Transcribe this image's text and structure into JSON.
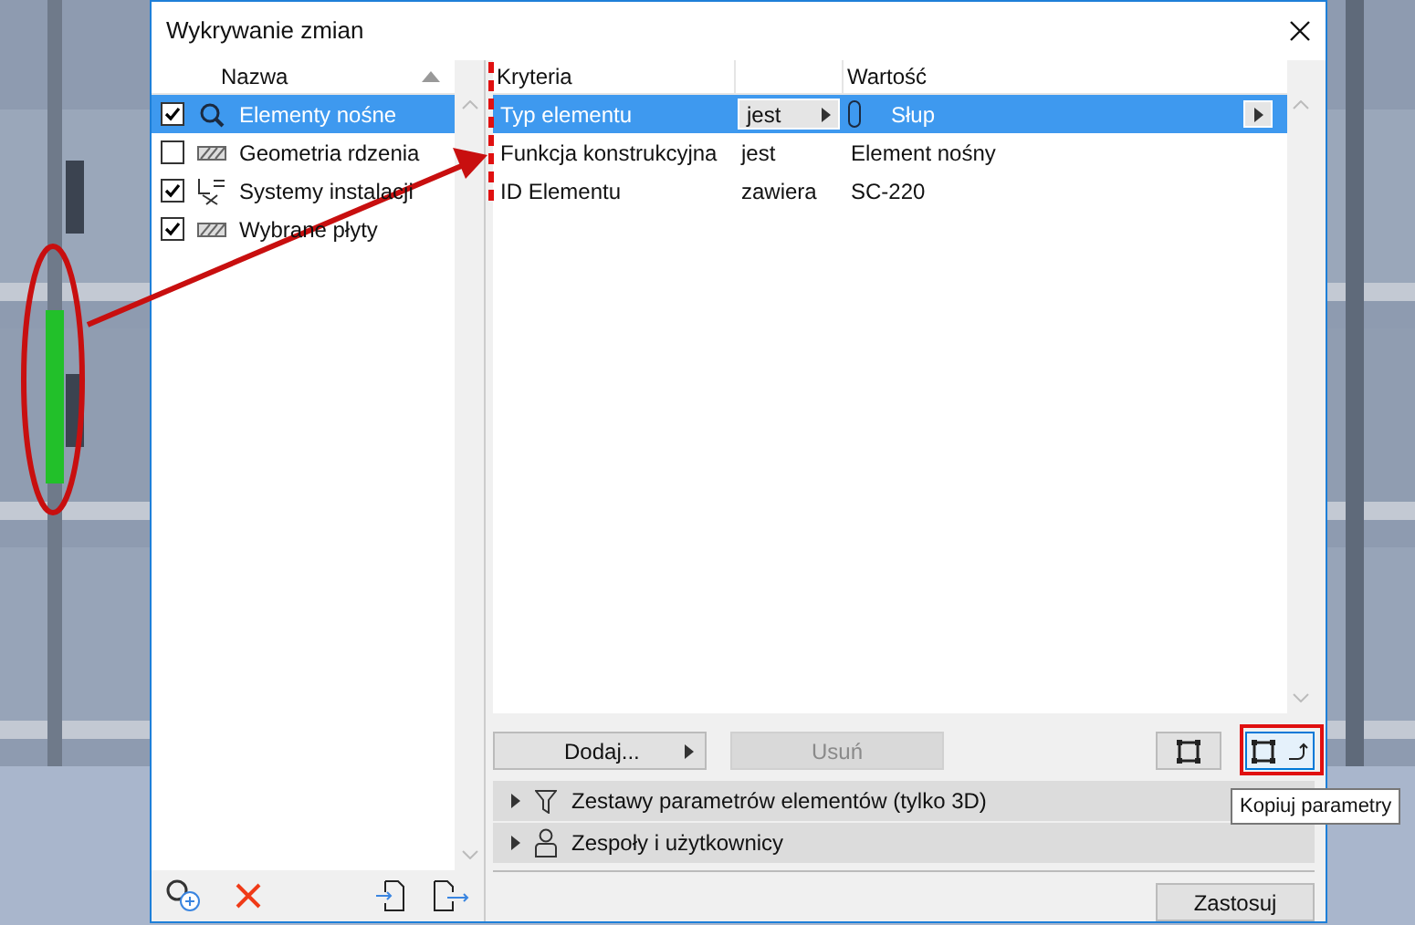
{
  "window": {
    "title": "Wykrywanie zmian"
  },
  "rules_header": {
    "label": "Nazwa"
  },
  "rules": [
    {
      "name": "Elementy nośne",
      "checked": true,
      "selected": true,
      "kind": "search"
    },
    {
      "name": "Geometria rdzenia",
      "checked": false,
      "selected": false,
      "kind": "hatch"
    },
    {
      "name": "Systemy instalacji",
      "checked": true,
      "selected": false,
      "kind": "systems"
    },
    {
      "name": "Wybrane płyty",
      "checked": true,
      "selected": false,
      "kind": "hatch"
    }
  ],
  "criteria": {
    "columns": [
      "Kryteria",
      "Wartość"
    ],
    "rows": [
      {
        "criterion": "Typ elementu",
        "operator": "jest",
        "value": "Słup",
        "selected": true
      },
      {
        "criterion": "Funkcja konstrukcyjna",
        "operator": "jest",
        "value": "Element nośny",
        "selected": false
      },
      {
        "criterion": "ID Elementu",
        "operator": "zawiera",
        "value": "SC-220",
        "selected": false
      }
    ]
  },
  "buttons": {
    "add": {
      "label": "Dodaj...",
      "disabled": false
    },
    "remove": {
      "label": "Usuń",
      "disabled": true
    }
  },
  "sections": [
    {
      "label": "Zestawy parametrów elementów (tylko 3D)",
      "kind": "filter",
      "expanded": false
    },
    {
      "label": "Zespoły i użytkownicy",
      "kind": "user",
      "expanded": false
    }
  ],
  "apply": {
    "label": "Zastosuj"
  },
  "tooltip": {
    "text": "Kopiuj parametry"
  }
}
